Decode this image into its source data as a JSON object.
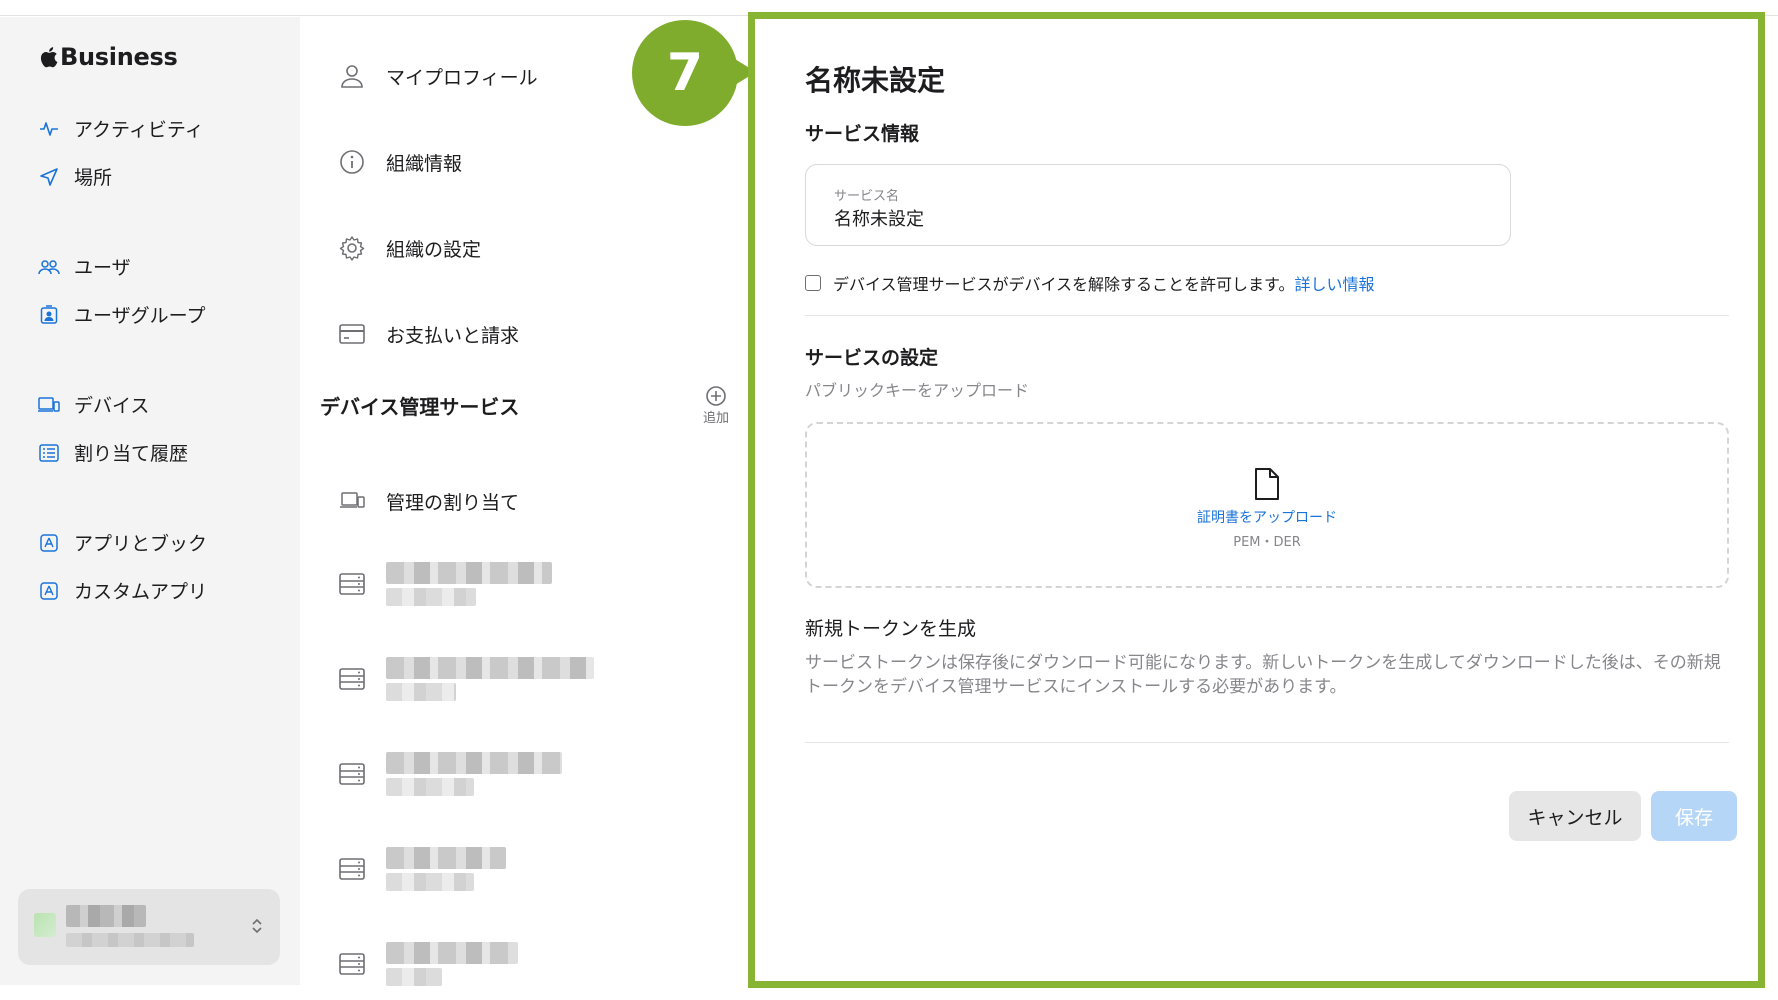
{
  "sidebar": {
    "brand": "Business",
    "items": [
      {
        "label": "アクティビティ",
        "icon": "activity-icon"
      },
      {
        "label": "場所",
        "icon": "location-arrow-icon"
      },
      {
        "label": "ユーザ",
        "icon": "users-icon"
      },
      {
        "label": "ユーザグループ",
        "icon": "user-group-icon"
      },
      {
        "label": "デバイス",
        "icon": "devices-icon"
      },
      {
        "label": "割り当て履歴",
        "icon": "list-icon"
      },
      {
        "label": "アプリとブック",
        "icon": "app-store-icon"
      },
      {
        "label": "カスタムアプリ",
        "icon": "app-store-icon"
      }
    ]
  },
  "middle": {
    "items": [
      {
        "label": "マイプロフィール",
        "icon": "person-icon"
      },
      {
        "label": "組織情報",
        "icon": "info-icon"
      },
      {
        "label": "組織の設定",
        "icon": "gear-icon"
      },
      {
        "label": "お支払いと請求",
        "icon": "credit-card-icon"
      }
    ],
    "section_title": "デバイス管理サービス",
    "add_label": "追加",
    "assign_label": "管理の割り当て"
  },
  "badge": {
    "number": "7",
    "color": "#7fac2c"
  },
  "form": {
    "title": "名称未設定",
    "service_info_heading": "サービス情報",
    "service_name_label": "サービス名",
    "service_name_value": "名称未設定",
    "checkbox_label": "デバイス管理サービスがデバイスを解除することを許可します。",
    "checkbox_link": "詳しい情報",
    "settings_heading": "サービスの設定",
    "settings_desc": "パブリックキーをアップロード",
    "upload_link": "証明書をアップロード",
    "upload_formats": "PEM・DER",
    "token_heading": "新規トークンを生成",
    "token_desc": "サービストークンは保存後にダウンロード可能になります。新しいトークンを生成してダウンロードした後は、その新規トークンをデバイス管理サービスにインストールする必要があります。",
    "cancel_label": "キャンセル",
    "save_label": "保存"
  },
  "colors": {
    "accent": "#1a73d9",
    "highlight_border": "#87b533",
    "save_disabled": "#b6d6f8"
  }
}
